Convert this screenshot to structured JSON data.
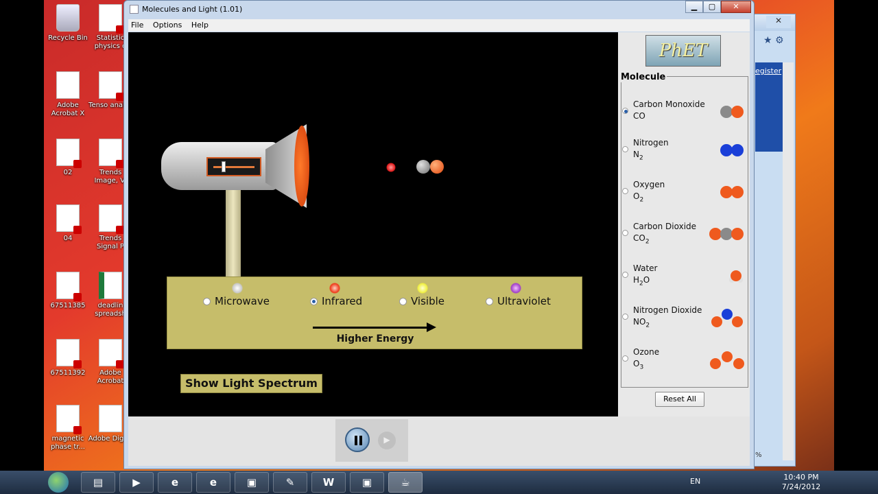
{
  "window": {
    "title": "Molecules and Light (1.01)",
    "minimize": "▁",
    "maximize": "▢",
    "close": "✕"
  },
  "menu": {
    "file": "File",
    "options": "Options",
    "help": "Help"
  },
  "desktop": [
    {
      "label": "Recycle Bin"
    },
    {
      "label": "Statistic physics d"
    },
    {
      "label": "Adobe Acrobat X"
    },
    {
      "label": "Tenso analys"
    },
    {
      "label": "02"
    },
    {
      "label": "Trends Image, Vi"
    },
    {
      "label": "04"
    },
    {
      "label": "Trends Signal P"
    },
    {
      "label": "67511385"
    },
    {
      "label": "deadlin spreadsh"
    },
    {
      "label": "67511392"
    },
    {
      "label": "Adobe Acrobat"
    },
    {
      "label": "magnetic phase tr..."
    },
    {
      "label": "Adobe Digita"
    }
  ],
  "light": {
    "microwave": "Microwave",
    "infrared": "Infrared",
    "visible": "Visible",
    "ultraviolet": "Ultraviolet",
    "selected": "Infrared",
    "higher": "Higher Energy",
    "spectrum_button": "Show Light Spectrum"
  },
  "panel": {
    "logo": "PhET",
    "legend": "Molecule",
    "reset": "Reset All",
    "molecules": [
      {
        "name": "Carbon Monoxide",
        "formula": "CO",
        "sub": "",
        "selected": true
      },
      {
        "name": "Nitrogen",
        "formula": "N",
        "sub": "2",
        "selected": false
      },
      {
        "name": "Oxygen",
        "formula": "O",
        "sub": "2",
        "selected": false
      },
      {
        "name": "Carbon Dioxide",
        "formula": "CO",
        "sub": "2",
        "selected": false
      },
      {
        "name": "Water",
        "formula": "H",
        "sub": "2",
        "tail": "O",
        "selected": false
      },
      {
        "name": "Nitrogen Dioxide",
        "formula": "NO",
        "sub": "2",
        "selected": false
      },
      {
        "name": "Ozone",
        "formula": "O",
        "sub": "3",
        "selected": false
      }
    ]
  },
  "bgwin": {
    "link": "egister",
    "zoom": "%"
  },
  "taskbar": {
    "lang": "EN",
    "time": "10:40 PM",
    "date": "7/24/2012"
  },
  "colors": {
    "carbon": "#8a8a8a",
    "oxygen": "#ef5a1e",
    "nitrogen": "#1a3fd8",
    "hydrogen": "#e0e0e0",
    "tray": "#c6bd6a"
  }
}
